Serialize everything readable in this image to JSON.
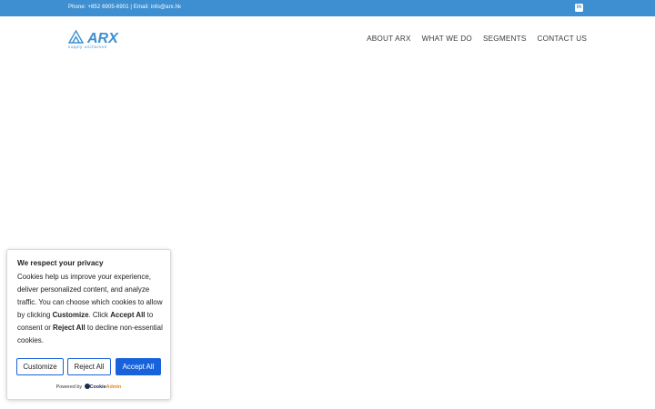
{
  "topbar": {
    "contact_text": "Phone: +852 6905-6901 | Email: info@arx.hk",
    "linkedin_glyph": "in",
    "background_color": "#3d8fd1"
  },
  "header": {
    "logo": {
      "wordmark": "ARX",
      "tagline": "supply·unchained",
      "color": "#3d8fd1"
    },
    "nav": [
      {
        "label": "ABOUT ARX"
      },
      {
        "label": "WHAT WE DO"
      },
      {
        "label": "SEGMENTS"
      },
      {
        "label": "CONTACT US"
      }
    ]
  },
  "cookie_banner": {
    "title": "We respect your privacy",
    "body": {
      "intro": "Cookies help us improve your experience, deliver personalized content, and analyze traffic. You can choose which cookies to allow by clicking ",
      "customize_word": "Customize",
      "mid1": ". Click ",
      "accept_word": "Accept All",
      "mid2": " to consent or ",
      "reject_word": "Reject All",
      "outro": " to decline non-essential cookies."
    },
    "buttons": {
      "customize": "Customize",
      "reject": "Reject All",
      "accept": "Accept All"
    },
    "accent_color": "#1863dc",
    "powered_by": {
      "prefix": "Powered by",
      "brand_main": "Cookie",
      "brand_highlight": "Admin"
    }
  }
}
